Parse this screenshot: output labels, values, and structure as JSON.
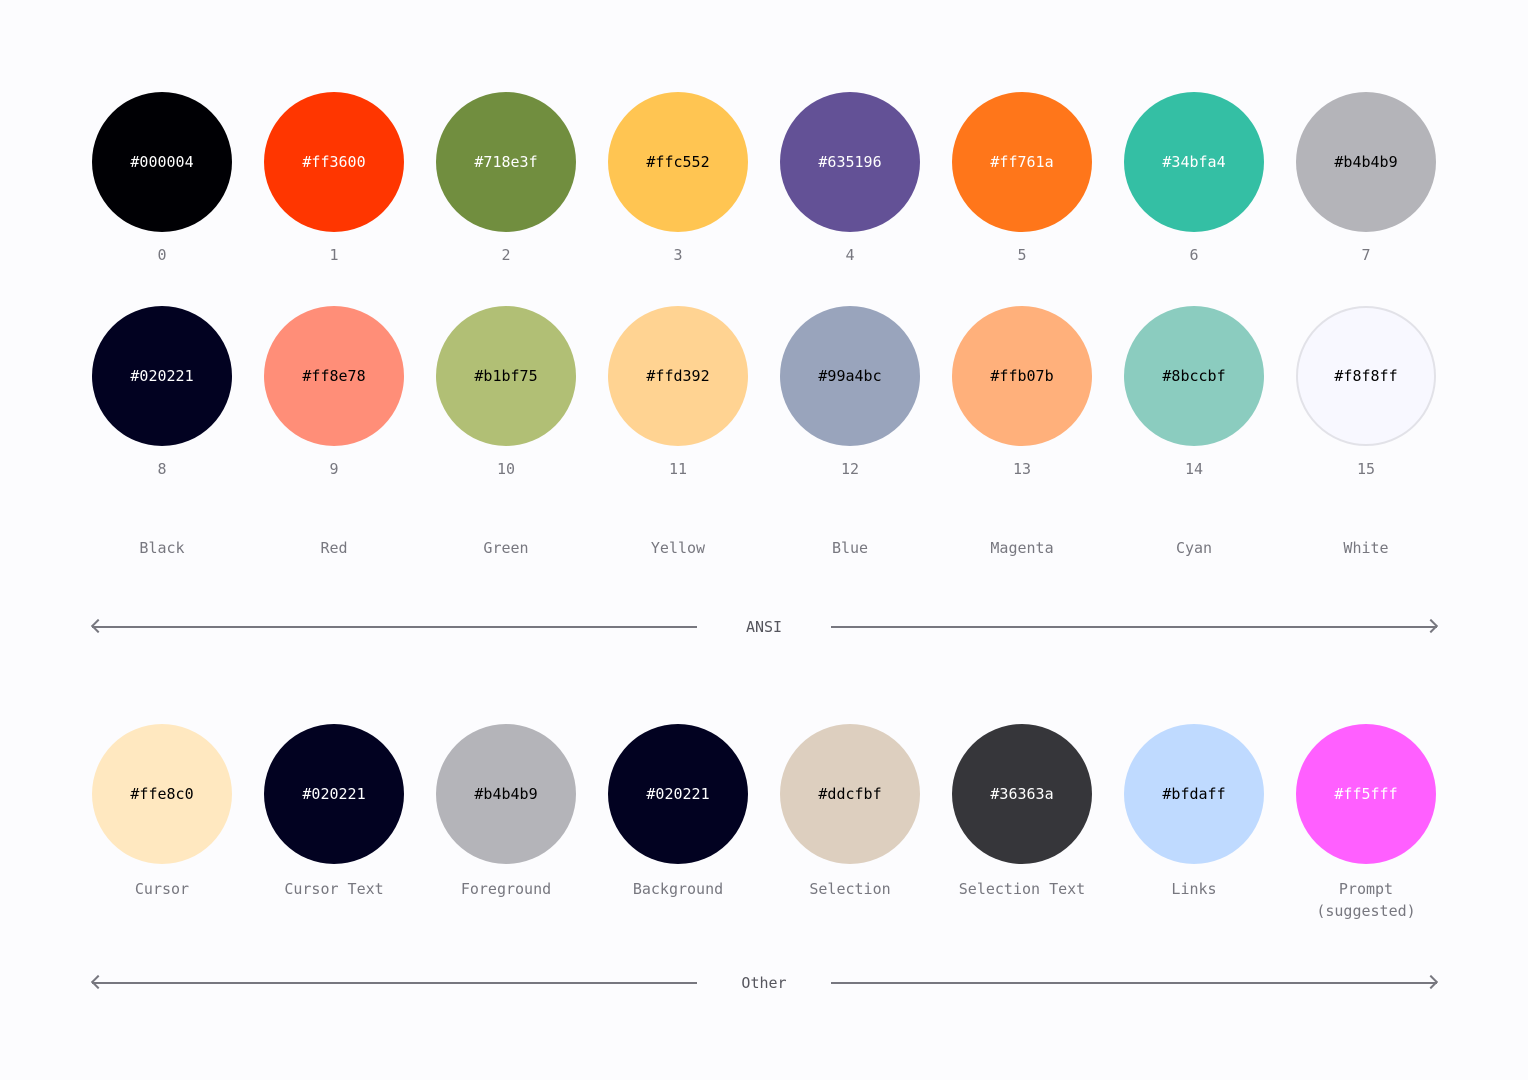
{
  "ansi": {
    "label": "ANSI",
    "normal": [
      {
        "index": "0",
        "hex": "#000004",
        "text_color": "#ffffff"
      },
      {
        "index": "1",
        "hex": "#ff3600",
        "text_color": "#ffffff"
      },
      {
        "index": "2",
        "hex": "#718e3f",
        "text_color": "#ffffff"
      },
      {
        "index": "3",
        "hex": "#ffc552",
        "text_color": "#000000"
      },
      {
        "index": "4",
        "hex": "#635196",
        "text_color": "#ffffff"
      },
      {
        "index": "5",
        "hex": "#ff761a",
        "text_color": "#ffffff"
      },
      {
        "index": "6",
        "hex": "#34bfa4",
        "text_color": "#ffffff"
      },
      {
        "index": "7",
        "hex": "#b4b4b9",
        "text_color": "#000000"
      }
    ],
    "bright": [
      {
        "index": "8",
        "hex": "#020221",
        "text_color": "#ffffff"
      },
      {
        "index": "9",
        "hex": "#ff8e78",
        "text_color": "#000000"
      },
      {
        "index": "10",
        "hex": "#b1bf75",
        "text_color": "#000000"
      },
      {
        "index": "11",
        "hex": "#ffd392",
        "text_color": "#000000"
      },
      {
        "index": "12",
        "hex": "#99a4bc",
        "text_color": "#000000"
      },
      {
        "index": "13",
        "hex": "#ffb07b",
        "text_color": "#000000"
      },
      {
        "index": "14",
        "hex": "#8bccbf",
        "text_color": "#000000"
      },
      {
        "index": "15",
        "hex": "#f8f8ff",
        "text_color": "#000000"
      }
    ],
    "names": [
      "Black",
      "Red",
      "Green",
      "Yellow",
      "Blue",
      "Magenta",
      "Cyan",
      "White"
    ]
  },
  "other": {
    "label": "Other",
    "items": [
      {
        "name": "Cursor",
        "hex": "#ffe8c0",
        "text_color": "#000000"
      },
      {
        "name": "Cursor Text",
        "hex": "#020221",
        "text_color": "#ffffff"
      },
      {
        "name": "Foreground",
        "hex": "#b4b4b9",
        "text_color": "#000000"
      },
      {
        "name": "Background",
        "hex": "#020221",
        "text_color": "#ffffff"
      },
      {
        "name": "Selection",
        "hex": "#ddcfbf",
        "text_color": "#000000"
      },
      {
        "name": "Selection Text",
        "hex": "#36363a",
        "text_color": "#ffffff"
      },
      {
        "name": "Links",
        "hex": "#bfdaff",
        "text_color": "#000000"
      },
      {
        "name": "Prompt",
        "name_line2": "(suggested)",
        "hex": "#ff5fff",
        "text_color": "#ffffff"
      }
    ]
  }
}
